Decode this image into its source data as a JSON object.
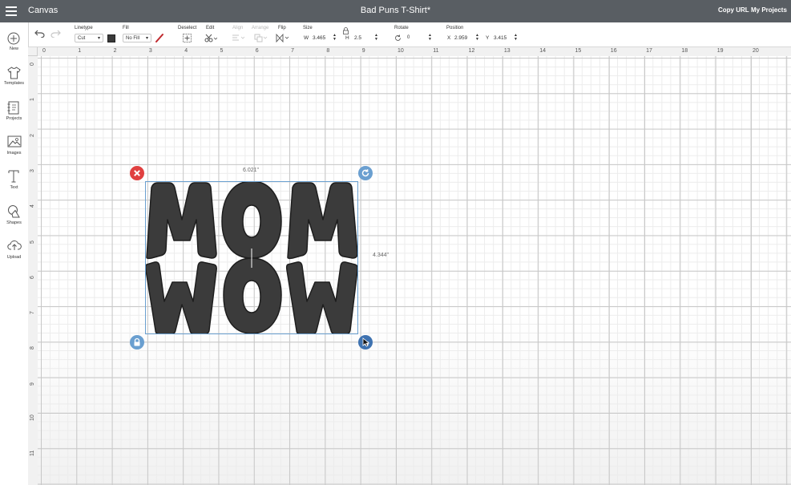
{
  "header": {
    "app_title": "Canvas",
    "document_title": "Bad Puns T-Shirt*",
    "copy_url": "Copy URL",
    "my_projects": "My Projects"
  },
  "toolbar": {
    "linetype": {
      "label": "Linetype",
      "value": "Cut"
    },
    "fill": {
      "label": "Fill",
      "value": "No Fill",
      "swatch_color": "#3a3a3a",
      "pen_color": "#c0282d"
    },
    "deselect": {
      "label": "Deselect"
    },
    "edit": {
      "label": "Edit"
    },
    "align": {
      "label": "Align"
    },
    "arrange": {
      "label": "Arrange"
    },
    "flip": {
      "label": "Flip"
    },
    "size": {
      "label": "Size",
      "w_label": "W",
      "w_value": "3.465",
      "h_label": "H",
      "h_value": "2.5"
    },
    "rotate": {
      "label": "Rotate",
      "value": "0"
    },
    "position": {
      "label": "Position",
      "x_label": "X",
      "x_value": "2.959",
      "y_label": "Y",
      "y_value": "3.415"
    }
  },
  "sidebar": {
    "items": [
      {
        "label": "New",
        "icon": "plus-circle-icon"
      },
      {
        "label": "Templates",
        "icon": "tshirt-icon"
      },
      {
        "label": "Projects",
        "icon": "projects-icon"
      },
      {
        "label": "Images",
        "icon": "image-icon"
      },
      {
        "label": "Text",
        "icon": "text-icon"
      },
      {
        "label": "Shapes",
        "icon": "shapes-icon"
      },
      {
        "label": "Upload",
        "icon": "upload-cloud-icon"
      }
    ]
  },
  "rulers": {
    "top": [
      "0",
      "1",
      "2",
      "3",
      "4",
      "5",
      "6",
      "7",
      "8",
      "9",
      "10",
      "11",
      "12",
      "13",
      "14",
      "15",
      "16",
      "17",
      "18",
      "19",
      "20"
    ],
    "left": [
      "0",
      "1",
      "2",
      "3",
      "4",
      "5",
      "6",
      "7",
      "8",
      "9",
      "10",
      "11"
    ]
  },
  "selection": {
    "width_label": "6.021\"",
    "height_label": "4.344\"",
    "shape_color": "#3b3b3b",
    "accent": "#6aa0d0",
    "delete_color": "#e04040",
    "lines": [
      "MOM",
      "WOW"
    ]
  }
}
